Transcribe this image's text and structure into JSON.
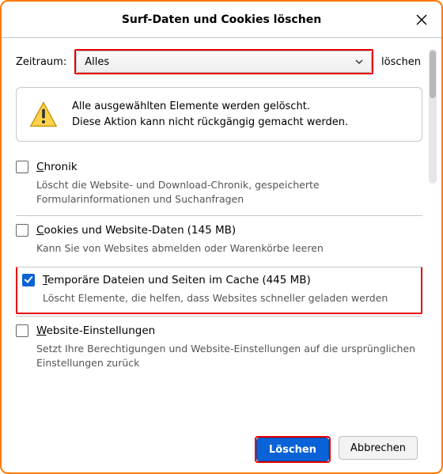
{
  "window_title": "Surf-Daten und Cookies löschen",
  "time_range": {
    "label": "Zeitraum:",
    "selected": "Alles",
    "suffix": "löschen"
  },
  "warning": {
    "line1": "Alle ausgewählten Elemente werden gelöscht.",
    "line2": "Diese Aktion kann nicht rückgängig gemacht werden."
  },
  "options": {
    "history": {
      "prefix": "C",
      "rest": "hronik",
      "desc": "Löscht die Website- und Download-Chronik, gespeicherte Formularinformationen und Suchanfragen",
      "checked": false
    },
    "cookies": {
      "prefix": "C",
      "rest": "ookies und Website-Daten",
      "size": "(145 MB)",
      "desc": "Kann Sie von Websites abmelden oder Warenkörbe leeren",
      "checked": false
    },
    "cache": {
      "prefix": "T",
      "rest": "emporäre Dateien und Seiten im Cache",
      "size": "(445 MB)",
      "desc": "Löscht Elemente, die helfen, dass Websites schneller geladen werden",
      "checked": true
    },
    "site_settings": {
      "prefix": "W",
      "rest": "ebsite-Einstellungen",
      "desc": "Setzt Ihre Berechtigungen und Website-Einstellungen auf die ursprünglichen Einstellungen zurück",
      "checked": false
    }
  },
  "buttons": {
    "confirm": "Löschen",
    "cancel": "Abbrechen"
  }
}
